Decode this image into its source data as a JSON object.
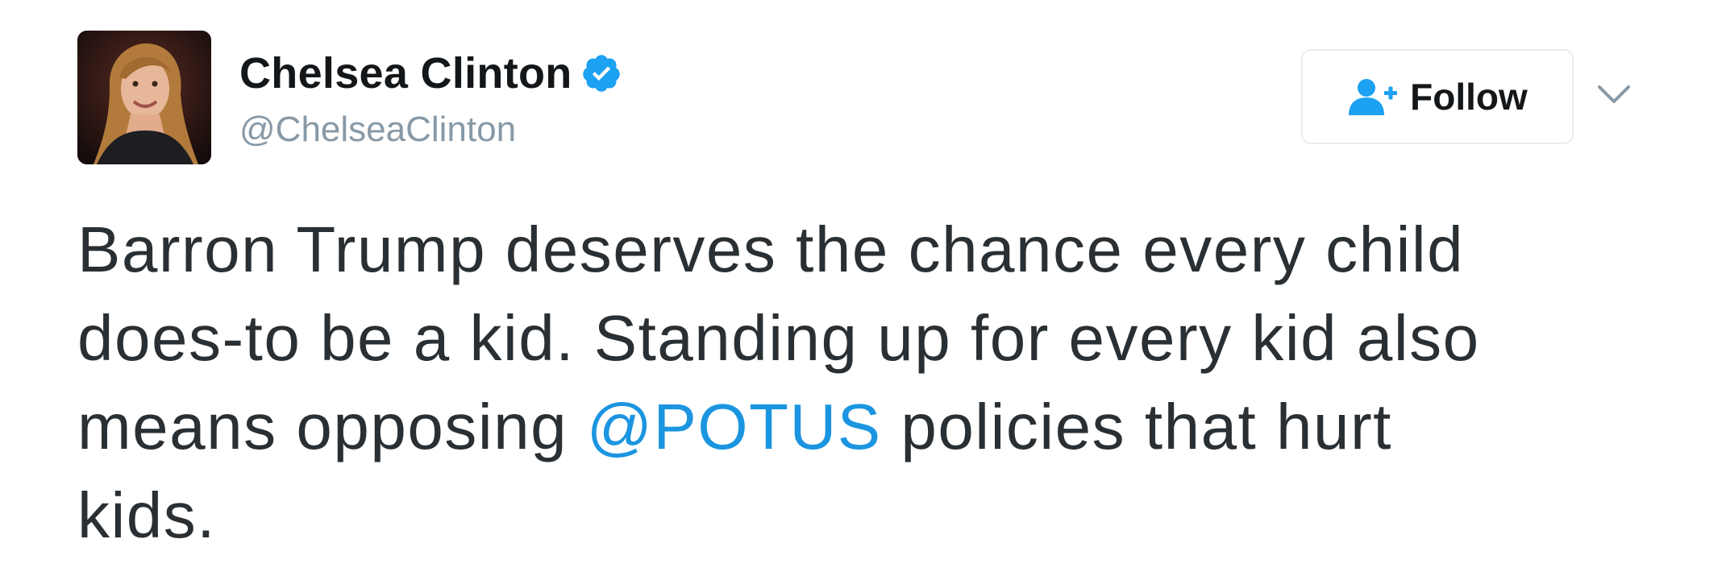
{
  "author": {
    "display_name": "Chelsea Clinton",
    "handle": "@ChelseaClinton",
    "verified": true
  },
  "actions": {
    "follow_label": "Follow"
  },
  "tweet": {
    "line1": "Barron Trump deserves the chance every child",
    "line2": "does-to be a kid. Standing up for every kid also",
    "line3_before": "means opposing ",
    "mention": "@POTUS",
    "line3_after": " policies that hurt",
    "line4": "kids."
  },
  "colors": {
    "link": "#1b95e0",
    "verified": "#1da1f2",
    "handle": "#8899a6",
    "text": "#292f33"
  },
  "icons": {
    "verified": "verified-badge-icon",
    "follow": "follow-user-icon",
    "more": "chevron-down-icon"
  }
}
